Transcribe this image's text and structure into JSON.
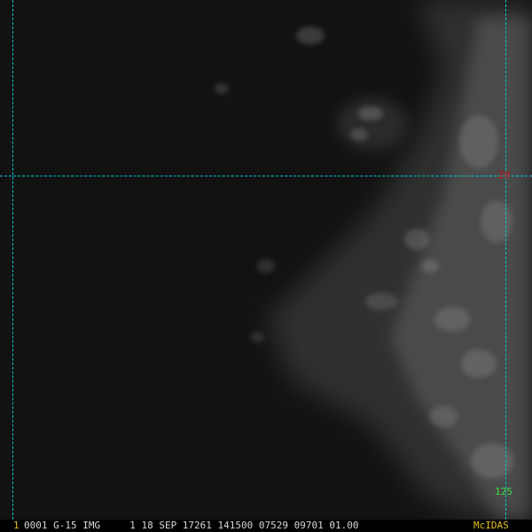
{
  "satellite_view": {
    "background": "#111111",
    "cloud_color": "#9a9a9a",
    "grid_color": "#00c8d4",
    "latitude_label": "20",
    "latitude_color": "#d01010",
    "longitude_label": "125",
    "longitude_color": "#3ee03e"
  },
  "status_bar": {
    "frame_number": "1",
    "frame_info": "0001 G-15 IMG     1 18 SEP 17261 141500 07529 09701 01.00",
    "brand": "McIDAS",
    "highlight_color": "#e6c21a"
  }
}
